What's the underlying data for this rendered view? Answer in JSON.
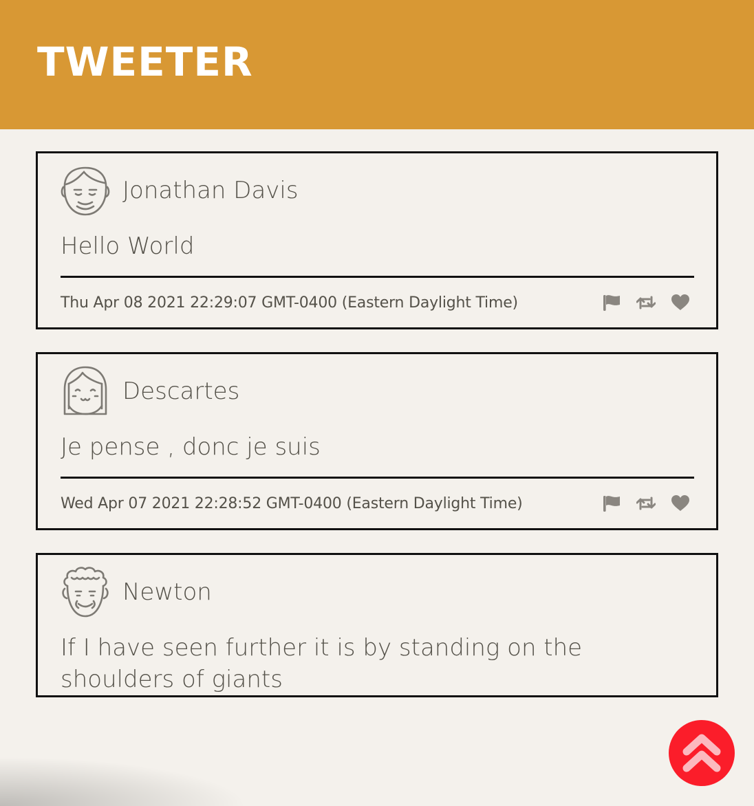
{
  "header": {
    "brand": "TWEETER",
    "background_color": "#d89834"
  },
  "tweets": [
    {
      "user": {
        "name": "Jonathan Davis",
        "avatar_icon": "smiling-man-avatar-icon"
      },
      "content": "Hello World",
      "created_at": "Thu Apr 08 2021 22:29:07 GMT-0400 (Eastern Daylight Time)",
      "actions": [
        "flag-icon",
        "retweet-icon",
        "heart-icon"
      ]
    },
    {
      "user": {
        "name": "Descartes",
        "avatar_icon": "bob-haircut-avatar-icon"
      },
      "content": "Je pense , donc je suis",
      "created_at": "Wed Apr 07 2021 22:28:52 GMT-0400 (Eastern Daylight Time)",
      "actions": [
        "flag-icon",
        "retweet-icon",
        "heart-icon"
      ]
    },
    {
      "user": {
        "name": "Newton",
        "avatar_icon": "curly-hair-avatar-icon"
      },
      "content": "If I have seen further it is by standing on the shoulders of giants"
    }
  ],
  "scroll_top_button": {
    "icon": "double-chevron-up-icon",
    "color": "#fb1d2a"
  },
  "colors": {
    "page_background": "#f4f1ec",
    "text": "#545149",
    "border": "#111111",
    "action_icons": "#8a8680"
  }
}
